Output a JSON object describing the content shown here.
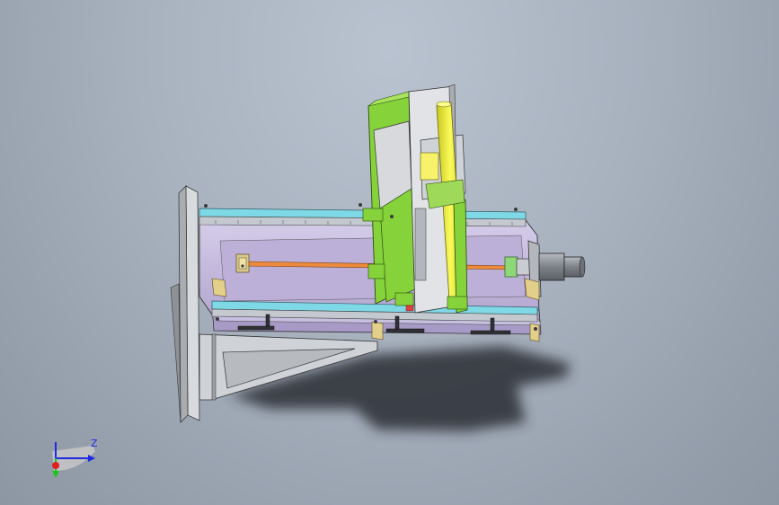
{
  "viewport": {
    "background": "#a8b2bf"
  },
  "model": {
    "icon": "cad-assembly-linear-module"
  },
  "triad": {
    "axis_label_z": "Z",
    "icon": "axis-triad-icon",
    "colors": {
      "x": "#e0201e",
      "y": "#1ec41e",
      "z": "#1d2ae0"
    }
  },
  "colors": {
    "frame_gray": "#c9cdd1",
    "body_purple": "#c3b7dc",
    "rail_cyan": "#7fd8e6",
    "plate_green": "#86d23a",
    "roller_yellow": "#f2f23a",
    "screw_orange": "#ee8a3c",
    "motor_gray": "#8c9097",
    "shadow": "#2a2d33"
  }
}
